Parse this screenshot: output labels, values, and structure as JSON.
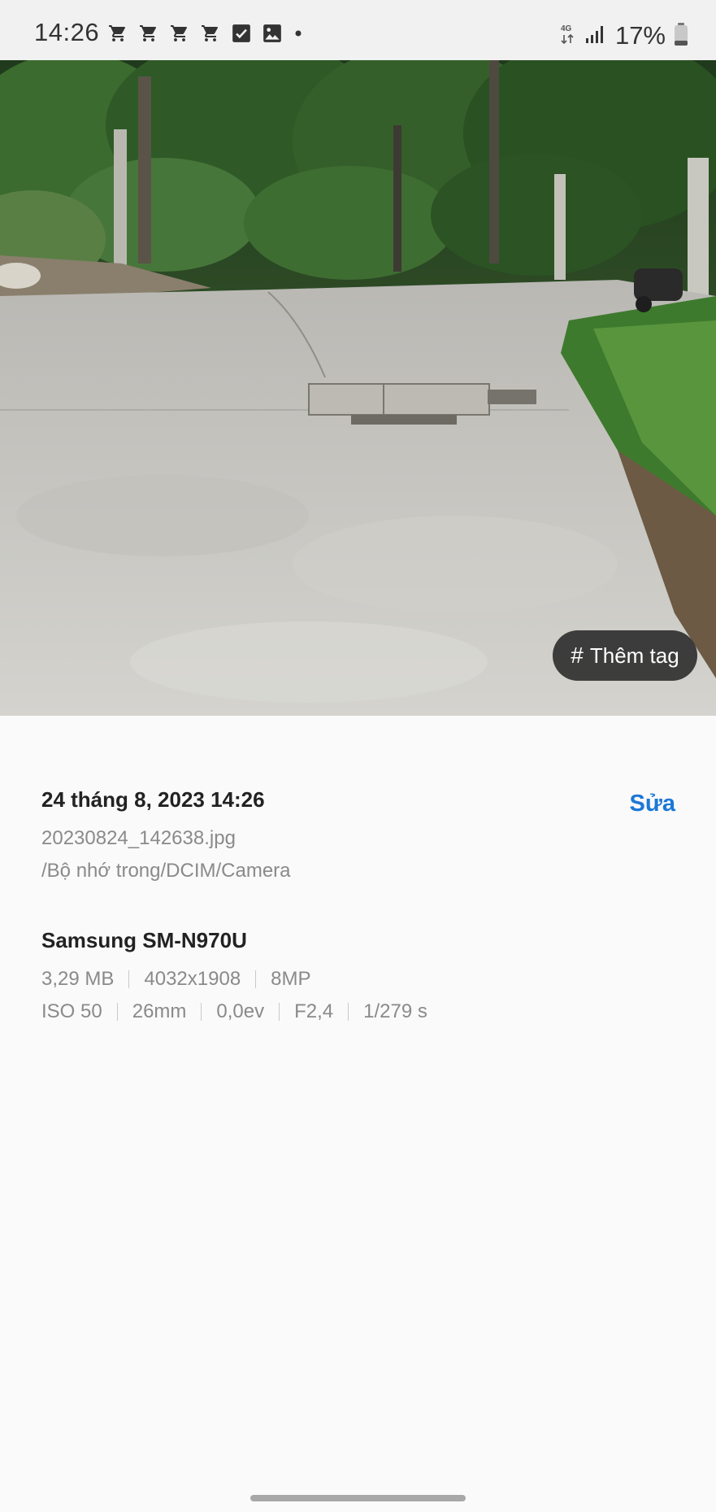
{
  "status_bar": {
    "time": "14:26",
    "battery": "17%",
    "network": "4G",
    "notification_icons": [
      "cart-icon",
      "cart-icon",
      "cart-icon",
      "cart-icon",
      "checkbox-icon",
      "image-icon",
      "dot-icon"
    ]
  },
  "photo": {
    "tag_button_symbol": "#",
    "tag_button_label": "Thêm tag"
  },
  "details": {
    "date": "24 tháng 8, 2023 14:26",
    "edit_label": "Sửa",
    "filename": "20230824_142638.jpg",
    "path": "/Bộ nhớ trong/DCIM/Camera",
    "device": "Samsung SM-N970U",
    "file_info": [
      "3,29 MB",
      "4032x1908",
      "8MP"
    ],
    "camera_info": [
      "ISO 50",
      "26mm",
      "0,0ev",
      "F2,4",
      "1/279 s"
    ]
  },
  "colors": {
    "accent": "#1c77d8",
    "background": "#fafafa",
    "status_bar": "#f1f1f1"
  }
}
